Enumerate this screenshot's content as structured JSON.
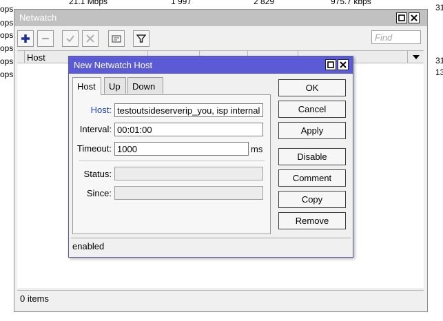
{
  "background": {
    "left_rows": [
      "ops",
      "ops",
      "ops",
      "ops",
      "ops",
      "ops"
    ],
    "top_values": [
      "21.1 Mbps",
      "1 997",
      "2 829",
      "975.7 kbps"
    ],
    "right_values": [
      "31",
      "31",
      "13"
    ]
  },
  "netwatch": {
    "title": "Netwatch",
    "find_placeholder": "Find",
    "columns": [
      "Host"
    ],
    "status": "0 items",
    "colors": {
      "title_bg": "#c1c1c1",
      "add_icon": "#1a2f8f"
    }
  },
  "dialog": {
    "title": "New Netwatch Host",
    "tabs": [
      "Host",
      "Up",
      "Down"
    ],
    "active_tab": "Host",
    "fields": {
      "host_label": "Host:",
      "host_value": "testoutsideserverip_you, isp internal",
      "interval_label": "Interval:",
      "interval_value": "00:01:00",
      "timeout_label": "Timeout:",
      "timeout_value": "1000",
      "timeout_unit": "ms",
      "status_label": "Status:",
      "status_value": "",
      "since_label": "Since:",
      "since_value": ""
    },
    "buttons": {
      "ok": "OK",
      "cancel": "Cancel",
      "apply": "Apply",
      "disable": "Disable",
      "comment": "Comment",
      "copy": "Copy",
      "remove": "Remove"
    },
    "status": "enabled",
    "colors": {
      "title_bg": "#5b5bd6",
      "host_label": "#1f3fbf"
    }
  }
}
